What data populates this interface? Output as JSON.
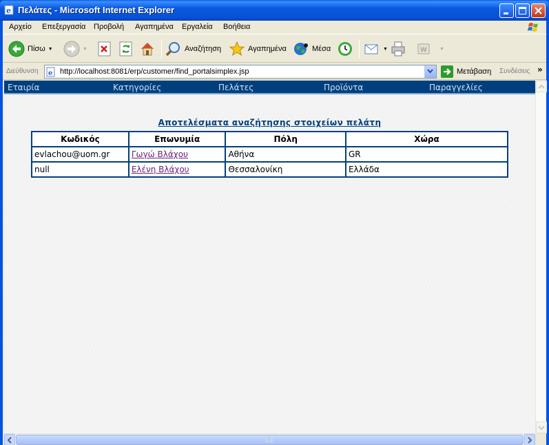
{
  "window": {
    "title": "Πελάτες - Microsoft Internet Explorer"
  },
  "menu": [
    "Αρχείο",
    "Επεξεργασία",
    "Προβολή",
    "Αγαπημένα",
    "Εργαλεία",
    "Βοήθεια"
  ],
  "toolbar": {
    "back": "Πίσω",
    "search": "Αναζήτηση",
    "favorites": "Αγαπημένα",
    "media": "Μέσα"
  },
  "address": {
    "label": "Διεύθυνση",
    "url": "http://localhost:8081/erp/customer/find_portalsimplex.jsp",
    "go": "Μετάβαση",
    "links": "Συνδέσεις"
  },
  "nav": [
    "Εταιρία",
    "Κατηγορίες",
    "Πελάτες",
    "Προϊόντα",
    "Παραγγελίες"
  ],
  "results": {
    "title": "Αποτελέσματα αναζήτησης στοιχείων πελάτη",
    "headers": [
      "Κωδικός",
      "Επωνυμία",
      "Πόλη",
      "Χώρα"
    ],
    "rows": [
      [
        "evlachou@uom.gr",
        "Γωγώ Βλάχου",
        "Αθήνα",
        "GR"
      ],
      [
        "null",
        "Ελένη Βλάχου",
        "Θεσσαλονίκη",
        "Ελλάδα"
      ]
    ]
  },
  "colors": {
    "nav_bar": "#003f7d",
    "nav_text": "#cfe2f7",
    "table_border": "#003f7d",
    "link_visited": "#6b1f7a"
  }
}
